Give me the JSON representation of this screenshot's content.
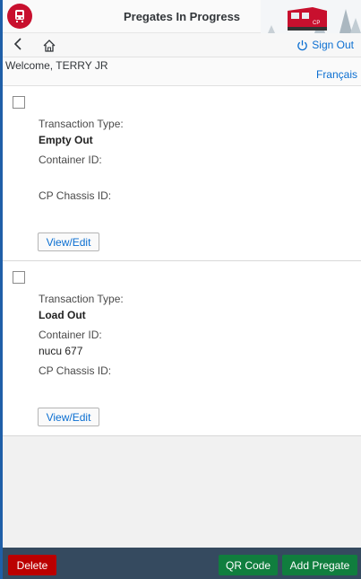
{
  "header": {
    "title": "Pregates In Progress",
    "brand_color": "#c8102e"
  },
  "nav": {
    "signout_label": "Sign Out"
  },
  "welcome": {
    "text": "Welcome, TERRY JR",
    "language_link": "Français"
  },
  "items": [
    {
      "transaction_type_label": "Transaction Type:",
      "transaction_type": "Empty Out",
      "container_id_label": "Container ID:",
      "container_id": "",
      "chassis_id_label": "CP Chassis ID:",
      "chassis_id": "",
      "view_edit_label": "View/Edit"
    },
    {
      "transaction_type_label": "Transaction Type:",
      "transaction_type": "Load Out",
      "container_id_label": "Container ID:",
      "container_id": "nucu 677",
      "chassis_id_label": "CP Chassis ID:",
      "chassis_id": "",
      "view_edit_label": "View/Edit"
    }
  ],
  "footer": {
    "delete_label": "Delete",
    "qr_label": "QR Code",
    "add_label": "Add Pregate",
    "delete_color": "#bb0000",
    "accept_color": "#107e3e",
    "bar_color": "#354a5f"
  }
}
